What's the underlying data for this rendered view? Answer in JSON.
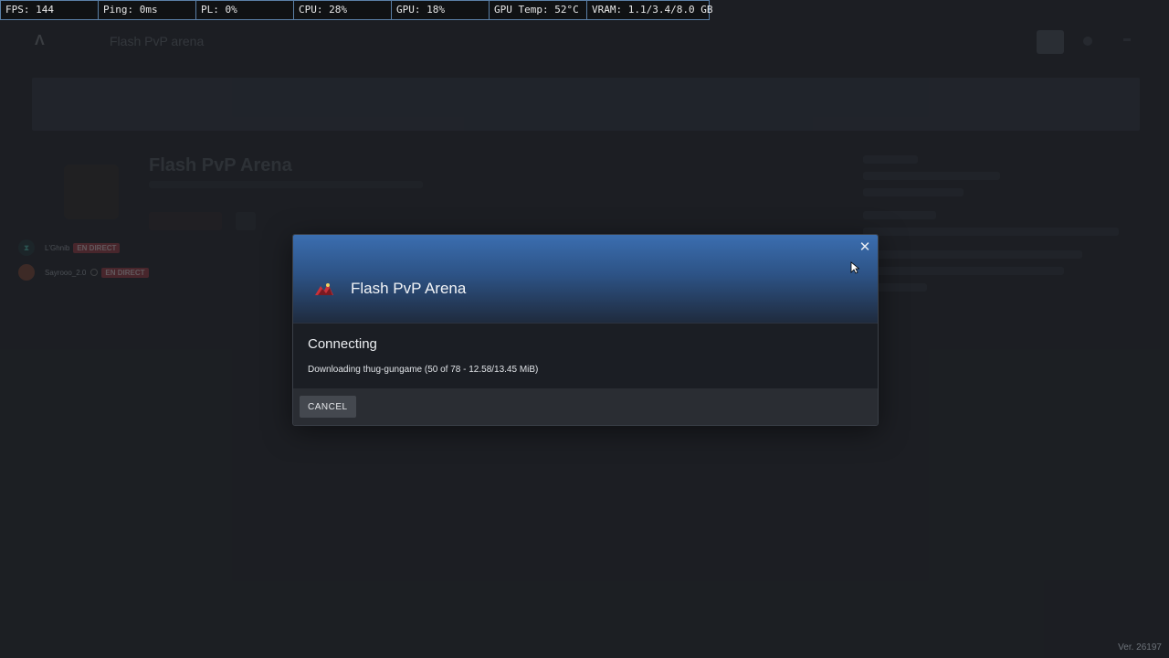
{
  "perf_overlay": {
    "fps": "FPS: 144",
    "ping": "Ping: 0ms",
    "pl": "PL: 0%",
    "cpu": "CPU: 28%",
    "gpu": "GPU: 18%",
    "gpu_temp": "GPU Temp: 52°C",
    "vram": "VRAM: 1.1/3.4/8.0 GB"
  },
  "background": {
    "app_title": "Flash PvP arena",
    "server_title": "Flash PvP Arena"
  },
  "streams": [
    {
      "name": "L'Ghnib",
      "badge": "EN DIRECT"
    },
    {
      "name": "Sayrooo_2.0",
      "badge": "EN DIRECT"
    }
  ],
  "modal": {
    "title": "Flash PvP Arena",
    "status": "Connecting",
    "progress": "Downloading thug-gungame (50 of 78 - 12.58/13.45 MiB)",
    "cancel_label": "CANCEL",
    "close_icon": "close-icon"
  },
  "footer": {
    "version": "Ver. 26197"
  }
}
